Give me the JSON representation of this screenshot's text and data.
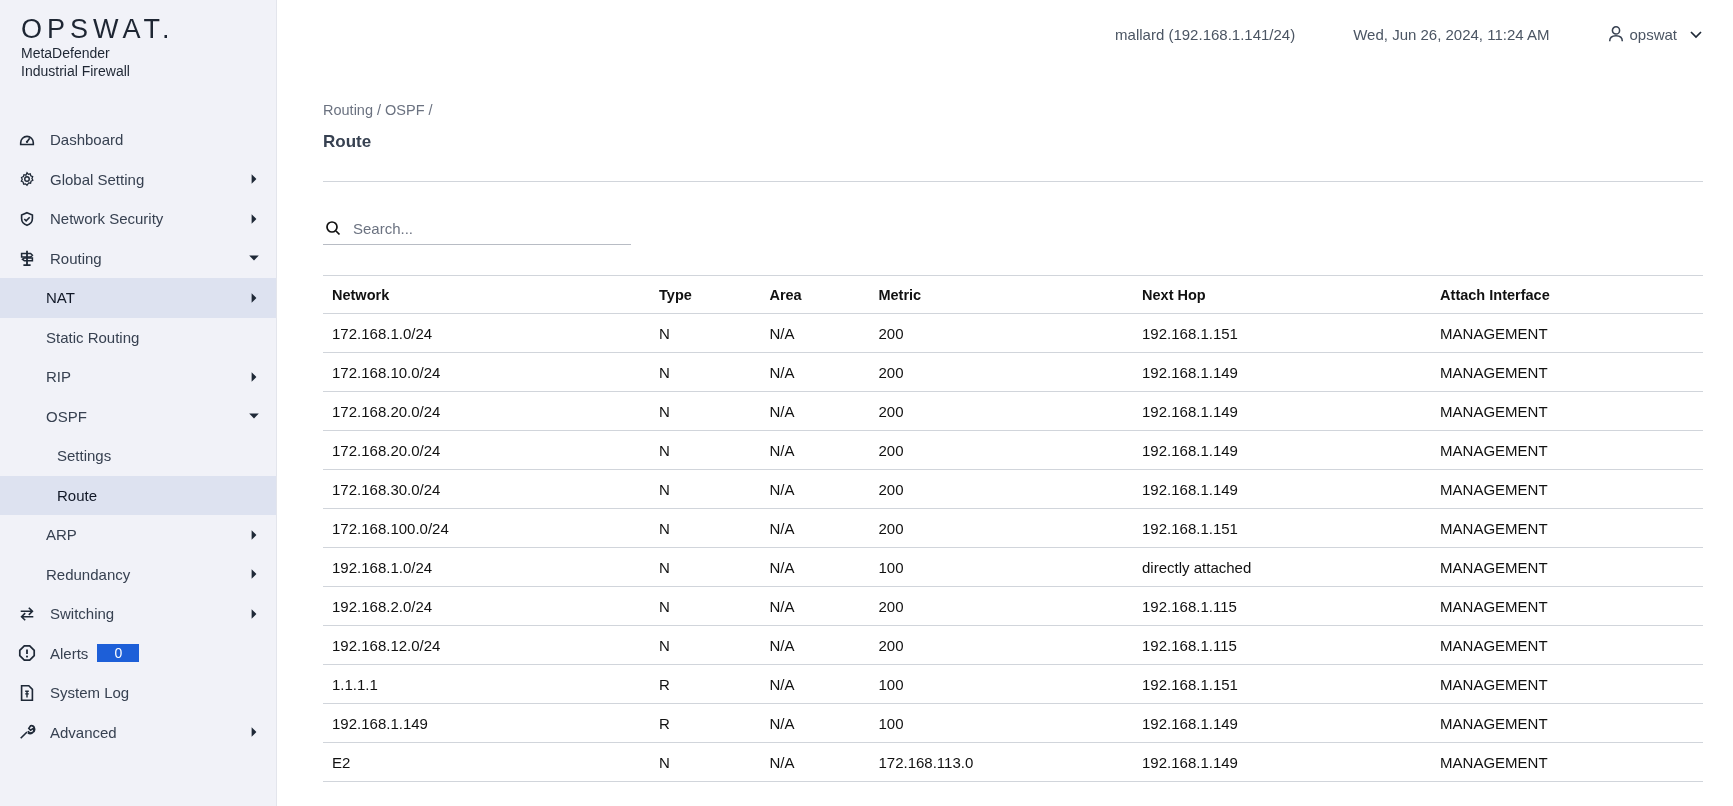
{
  "brand": {
    "logo": "OPSWAT.",
    "product_line1": "MetaDefender",
    "product_line2": "Industrial Firewall"
  },
  "sidebar": {
    "items": [
      {
        "label": "Dashboard",
        "selected": false
      },
      {
        "label": "Global Setting",
        "selected": false,
        "expanded": false
      },
      {
        "label": "Network Security",
        "selected": false,
        "expanded": false
      },
      {
        "label": "Routing",
        "selected": false,
        "expanded": true,
        "children": [
          {
            "label": "NAT",
            "selected": true,
            "expanded": false
          },
          {
            "label": "Static Routing",
            "selected": false
          },
          {
            "label": "RIP",
            "selected": false,
            "expanded": false
          },
          {
            "label": "OSPF",
            "selected": false,
            "expanded": true,
            "children": [
              {
                "label": "Settings",
                "selected": false
              },
              {
                "label": "Route",
                "selected": true
              }
            ]
          },
          {
            "label": "ARP",
            "selected": false,
            "expanded": false
          },
          {
            "label": "Redundancy",
            "selected": false,
            "expanded": false
          }
        ]
      },
      {
        "label": "Switching",
        "selected": false,
        "expanded": false
      },
      {
        "label": "Alerts",
        "selected": false,
        "badge": "0"
      },
      {
        "label": "System Log",
        "selected": false
      },
      {
        "label": "Advanced",
        "selected": false,
        "expanded": false
      }
    ]
  },
  "top_bar": {
    "host": "mallard (192.168.1.141/24)",
    "datetime": "Wed, Jun 26, 2024, 11:24 AM",
    "user": "opswat"
  },
  "breadcrumb": "Routing / OSPF /",
  "page_title": "Route",
  "search": {
    "placeholder": "Search..."
  },
  "table": {
    "columns": [
      "Network",
      "Type",
      "Area",
      "Metric",
      "Next Hop",
      "Attach Interface"
    ],
    "rows": [
      [
        "172.168.1.0/24",
        "N",
        "N/A",
        "200",
        "192.168.1.151",
        "MANAGEMENT"
      ],
      [
        "172.168.10.0/24",
        "N",
        "N/A",
        "200",
        "192.168.1.149",
        "MANAGEMENT"
      ],
      [
        "172.168.20.0/24",
        "N",
        "N/A",
        "200",
        "192.168.1.149",
        "MANAGEMENT"
      ],
      [
        "172.168.20.0/24",
        "N",
        "N/A",
        "200",
        "192.168.1.149",
        "MANAGEMENT"
      ],
      [
        "172.168.30.0/24",
        "N",
        "N/A",
        "200",
        "192.168.1.149",
        "MANAGEMENT"
      ],
      [
        "172.168.100.0/24",
        "N",
        "N/A",
        "200",
        "192.168.1.151",
        "MANAGEMENT"
      ],
      [
        "192.168.1.0/24",
        "N",
        "N/A",
        "100",
        "directly attached",
        "MANAGEMENT"
      ],
      [
        "192.168.2.0/24",
        "N",
        "N/A",
        "200",
        "192.168.1.115",
        "MANAGEMENT"
      ],
      [
        "192.168.12.0/24",
        "N",
        "N/A",
        "200",
        "192.168.1.115",
        "MANAGEMENT"
      ],
      [
        "1.1.1.1",
        "R",
        "N/A",
        "100",
        "192.168.1.151",
        "MANAGEMENT"
      ],
      [
        "192.168.1.149",
        "R",
        "N/A",
        "100",
        "192.168.1.149",
        "MANAGEMENT"
      ],
      [
        "E2",
        "N",
        "N/A",
        "172.168.113.0",
        "192.168.1.149",
        "MANAGEMENT"
      ]
    ]
  }
}
